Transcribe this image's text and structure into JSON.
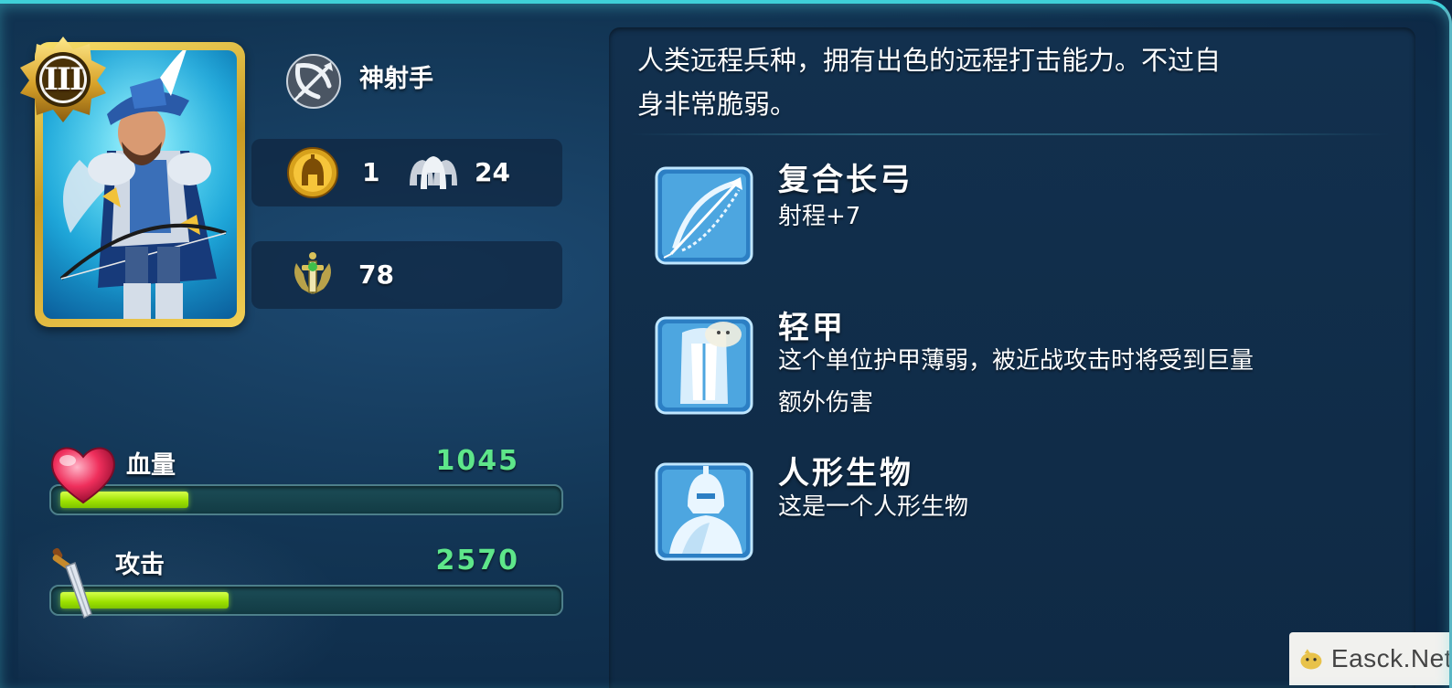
{
  "card": {
    "rank": "III",
    "hero": "archer-hero-portrait"
  },
  "unit": {
    "name": "神射手",
    "type_icon": "crossbow-icon"
  },
  "stats": {
    "leadership_icon": "helmet-icon",
    "leadership": "1",
    "squad_icon": "troop-helmets-icon",
    "squad_size": "24",
    "power_icon": "sword-emblem-icon",
    "power": "78"
  },
  "bars": {
    "hp": {
      "label": "血量",
      "value": "1045",
      "fill_fraction": 0.26,
      "icon": "heart-icon"
    },
    "attack": {
      "label": "攻击",
      "value": "2570",
      "fill_fraction": 0.34,
      "icon": "sword-icon"
    }
  },
  "description": {
    "line1": "人类远程兵种，拥有出色的远程打击能力。不过自",
    "line2": "身非常脆弱。"
  },
  "skills": [
    {
      "title": "复合长弓",
      "desc": "射程+7",
      "icon": "longbow-icon"
    },
    {
      "title": "轻甲",
      "desc_line1": "这个单位护甲薄弱，被近战攻击时将受到巨量",
      "desc_line2": "额外伤害",
      "icon": "light-armor-icon"
    },
    {
      "title": "人形生物",
      "desc": "这是一个人形生物",
      "icon": "humanoid-icon"
    }
  ],
  "watermark": {
    "text": "Easck.Net"
  },
  "colors": {
    "bar_fill": "#9ce000",
    "bar_value": "#5ee68a",
    "card_gold": "#e3b83a",
    "panel_bg": "#12304e"
  }
}
